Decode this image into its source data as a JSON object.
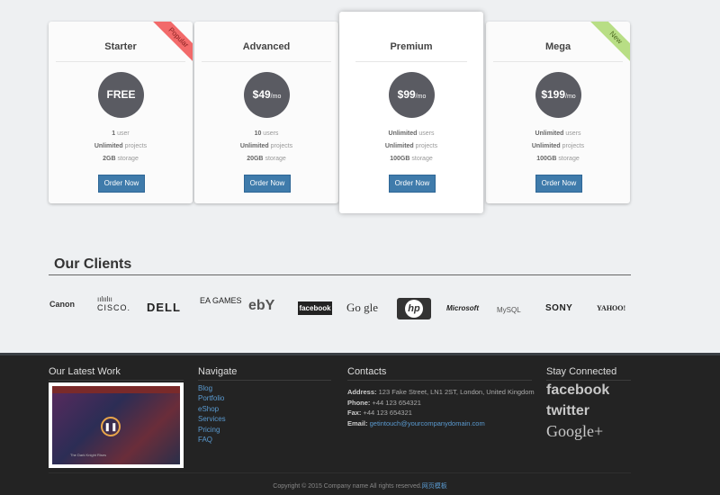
{
  "pricing": {
    "plans": [
      {
        "name": "Starter",
        "price": "FREE",
        "per": "",
        "f1a": "1",
        "f1b": " user",
        "f2a": "Unlimited",
        "f2b": " projects",
        "f3a": "2GB",
        "f3b": " storage",
        "button": "Order Now",
        "ribbon": "Popular"
      },
      {
        "name": "Advanced",
        "price": "$49",
        "per": "/mo",
        "f1a": "10",
        "f1b": " users",
        "f2a": "Unlimited",
        "f2b": " projects",
        "f3a": "20GB",
        "f3b": " storage",
        "button": "Order Now",
        "ribbon": ""
      },
      {
        "name": "Premium",
        "price": "$99",
        "per": "/mo",
        "f1a": "Unlimited",
        "f1b": " users",
        "f2a": "Unlimited",
        "f2b": " projects",
        "f3a": "100GB",
        "f3b": " storage",
        "button": "Order Now",
        "ribbon": ""
      },
      {
        "name": "Mega",
        "price": "$199",
        "per": "/mo",
        "f1a": "Unlimited",
        "f1b": " users",
        "f2a": "Unlimited",
        "f2b": " projects",
        "f3a": "100GB",
        "f3b": " storage",
        "button": "Order Now",
        "ribbon": "New"
      }
    ]
  },
  "clients": {
    "title": "Our Clients",
    "logos": [
      "Canon",
      "CISCO.",
      "DELL",
      "EA GAMES",
      "ebY",
      "facebook",
      "Go gle",
      "hp",
      "Microsoft",
      "MySQL",
      "SONY",
      "YAHOO!"
    ]
  },
  "footer": {
    "work_title": "Our Latest Work",
    "work_caption": "The Dark Knight Rises",
    "nav_title": "Navigate",
    "nav_items": [
      "Blog",
      "Portfolio",
      "eShop",
      "Services",
      "Pricing",
      "FAQ"
    ],
    "contacts_title": "Contacts",
    "address_label": "Address:",
    "address": " 123 Fake Street, LN1 2ST, London, United Kingdom",
    "phone_label": "Phone:",
    "phone": " +44 123 654321",
    "fax_label": "Fax:",
    "fax": " +44 123 654321",
    "email_label": "Email:",
    "email": "getintouch@yourcompanydomain.com",
    "social_title": "Stay Connected",
    "social": [
      "facebook",
      "twitter",
      "Google+"
    ],
    "copyright": "Copyright © 2015 Company name All rights reserved.",
    "copyright_link": "网页模板"
  },
  "colors": {
    "accent": "#3f7bab",
    "circle": "#5a5b62",
    "footer_bg": "#232323",
    "link": "#5a9ad0",
    "ribbon_popular": "#f26a6a",
    "ribbon_new": "#b8de85"
  }
}
